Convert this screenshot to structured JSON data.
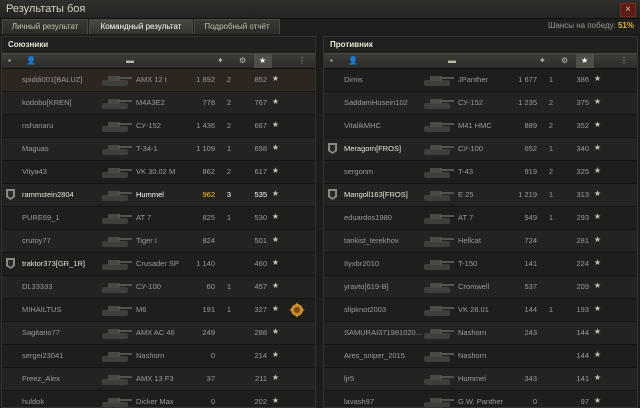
{
  "window": {
    "title": "Результаты боя",
    "close": "×"
  },
  "tabs": [
    {
      "label": "Личный результат"
    },
    {
      "label": "Командный результат"
    },
    {
      "label": "Подробный отчёт"
    }
  ],
  "victory_chance": {
    "label": "Шансы на победу:",
    "value": "51%"
  },
  "allies": {
    "title": "Союзники",
    "players": [
      {
        "name": "spiddi001[BALUZ]",
        "tank": "AMX 12 t",
        "damage": "1 892",
        "kills": "2",
        "xp": "852",
        "star": "★"
      },
      {
        "name": "kodobo[KREN]",
        "tank": "M4A3E2",
        "damage": "778",
        "kills": "2",
        "xp": "767",
        "star": "★"
      },
      {
        "name": "nshanaru",
        "tank": "СУ-152",
        "damage": "1 436",
        "kills": "2",
        "xp": "667",
        "star": "★"
      },
      {
        "name": "Maguas",
        "tank": "T-34-1",
        "damage": "1 109",
        "kills": "1",
        "xp": "658",
        "star": "★"
      },
      {
        "name": "Vitya43",
        "tank": "VK 30.02 M",
        "damage": "862",
        "kills": "2",
        "xp": "617",
        "star": "★"
      },
      {
        "name": "rammstein2804",
        "tank": "Hummel",
        "damage": "962",
        "kills": "3",
        "xp": "535",
        "star": "★"
      },
      {
        "name": "PURE69_1",
        "tank": "AT 7",
        "damage": "825",
        "kills": "1",
        "xp": "530",
        "star": "★"
      },
      {
        "name": "crutoy77",
        "tank": "Tiger I",
        "damage": "824",
        "kills": "",
        "xp": "501",
        "star": "★"
      },
      {
        "name": "traktor373[GR_1R]",
        "tank": "Crusader SP",
        "damage": "1 140",
        "kills": "",
        "xp": "460",
        "star": "★"
      },
      {
        "name": "DL33333",
        "tank": "СУ-100",
        "damage": "60",
        "kills": "1",
        "xp": "457",
        "star": "★"
      },
      {
        "name": "MIHAILTUS",
        "tank": "M6",
        "damage": "191",
        "kills": "1",
        "xp": "327",
        "star": "★"
      },
      {
        "name": "Sagitario77",
        "tank": "AMX AC 46",
        "damage": "249",
        "kills": "",
        "xp": "288",
        "star": "★"
      },
      {
        "name": "sergei23041",
        "tank": "Nashorn",
        "damage": "0",
        "kills": "",
        "xp": "214",
        "star": "★"
      },
      {
        "name": "Freez_Alex",
        "tank": "AMX 13 F3",
        "damage": "37",
        "kills": "",
        "xp": "211",
        "star": "★"
      },
      {
        "name": "huldok",
        "tank": "Dicker Max",
        "damage": "0",
        "kills": "",
        "xp": "202",
        "star": "★"
      }
    ]
  },
  "enemies": {
    "title": "Противник",
    "players": [
      {
        "name": "Dimis",
        "tank": "JPanther",
        "damage": "1 677",
        "kills": "1",
        "xp": "386",
        "star": "★"
      },
      {
        "name": "SaddamHusein102",
        "tank": "СУ-152",
        "damage": "1 235",
        "kills": "2",
        "xp": "375",
        "star": "★"
      },
      {
        "name": "VitalikMHC",
        "tank": "M41 HMC",
        "damage": "889",
        "kills": "2",
        "xp": "352",
        "star": "★"
      },
      {
        "name": "Meragorn[FROS]",
        "tank": "СУ-100",
        "damage": "652",
        "kills": "1",
        "xp": "340",
        "star": "★"
      },
      {
        "name": "sergonm",
        "tank": "T-43",
        "damage": "919",
        "kills": "2",
        "xp": "325",
        "star": "★"
      },
      {
        "name": "Mangoll163[FROS]",
        "tank": "E 25",
        "damage": "1 219",
        "kills": "1",
        "xp": "313",
        "star": "★"
      },
      {
        "name": "eduardos1980",
        "tank": "AT 7",
        "damage": "949",
        "kills": "1",
        "xp": "293",
        "star": "★"
      },
      {
        "name": "tankist_terekhov",
        "tank": "Hellcat",
        "damage": "724",
        "kills": "",
        "xp": "281",
        "star": "★"
      },
      {
        "name": "Ityxbr2010",
        "tank": "T-150",
        "damage": "141",
        "kills": "",
        "xp": "224",
        "star": "★"
      },
      {
        "name": "yravto[619-B]",
        "tank": "Cromwell",
        "damage": "537",
        "kills": "",
        "xp": "209",
        "star": "★"
      },
      {
        "name": "slipknot2003",
        "tank": "VK 28.01",
        "damage": "144",
        "kills": "1",
        "xp": "193",
        "star": "★"
      },
      {
        "name": "SAMURAI371981020...",
        "tank": "Nashorn",
        "damage": "243",
        "kills": "",
        "xp": "144",
        "star": "★"
      },
      {
        "name": "Ares_sniper_2015",
        "tank": "Nashorn",
        "damage": "",
        "kills": "",
        "xp": "144",
        "star": "★"
      },
      {
        "name": "ljr5",
        "tank": "Hummel",
        "damage": "343",
        "kills": "",
        "xp": "141",
        "star": "★"
      },
      {
        "name": "lavash97",
        "tank": "G.W. Panther",
        "damage": "0",
        "kills": "",
        "xp": "97",
        "star": "★"
      }
    ]
  },
  "colors": {
    "accent": "#e6b32b",
    "self_damage": "#f0c020"
  }
}
